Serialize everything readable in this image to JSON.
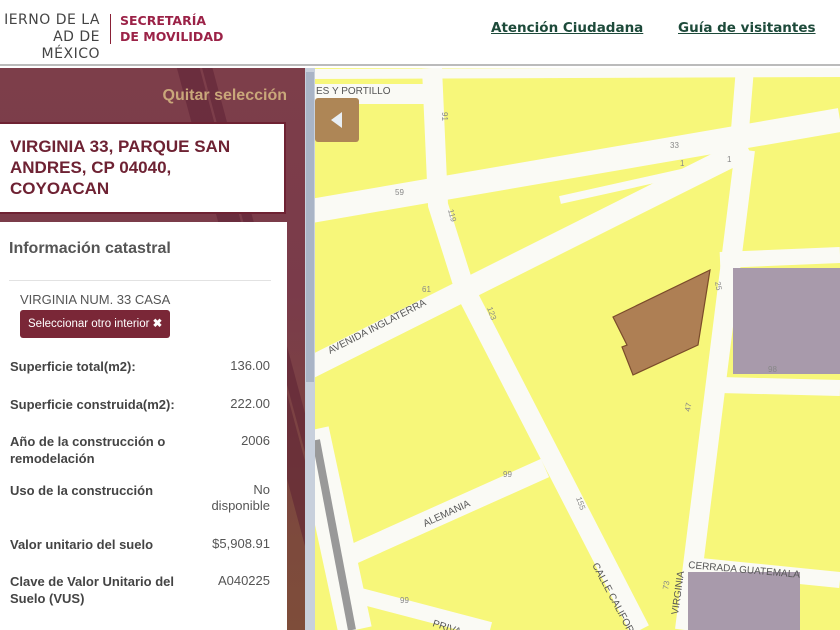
{
  "header": {
    "logo_left_line1": "IERNO DE LA",
    "logo_left_line2": "AD DE MÉXICO",
    "logo_right_line1": "SECRETARÍA",
    "logo_right_line2": "DE MOVILIDAD",
    "nav": [
      "Atención Ciudadana",
      "Guía de visitantes"
    ]
  },
  "panel": {
    "quitar": "Quitar selección",
    "address": "VIRGINIA 33, PARQUE SAN ANDRES, CP 04040, COYOACAN",
    "info_title": "Información catastral",
    "interior": "VIRGINIA NUM. 33 CASA",
    "otro_btn": "Seleccionar otro interior",
    "rows": [
      {
        "label": "Superficie total(m2):",
        "value": "136.00"
      },
      {
        "label": "Superficie construida(m2):",
        "value": "222.00"
      },
      {
        "label": "Año de la construcción o remodelación",
        "value": "2006"
      },
      {
        "label": "Uso de la construcción",
        "value": "No disponible"
      },
      {
        "label": "Valor unitario del suelo",
        "value": "$5,908.91"
      },
      {
        "label": "Clave de Valor Unitario del Suelo (VUS)",
        "value": "A040225"
      }
    ]
  },
  "map": {
    "streets": [
      "ES Y PORTILLO",
      "AVENIDA INGLATERRA",
      "ALEMANIA",
      "CALLE CALIFOR",
      "VIRGINIA",
      "CERRADA GUATEMALA",
      "PRIVA"
    ],
    "numbers": [
      "91",
      "33",
      "59",
      "1",
      "1",
      "119",
      "61",
      "123",
      "25",
      "98",
      "47",
      "99",
      "155",
      "73",
      "99"
    ],
    "colors": {
      "block": "#f7f77a",
      "selected": "#ae7f54",
      "purple": "#a89aab"
    }
  }
}
